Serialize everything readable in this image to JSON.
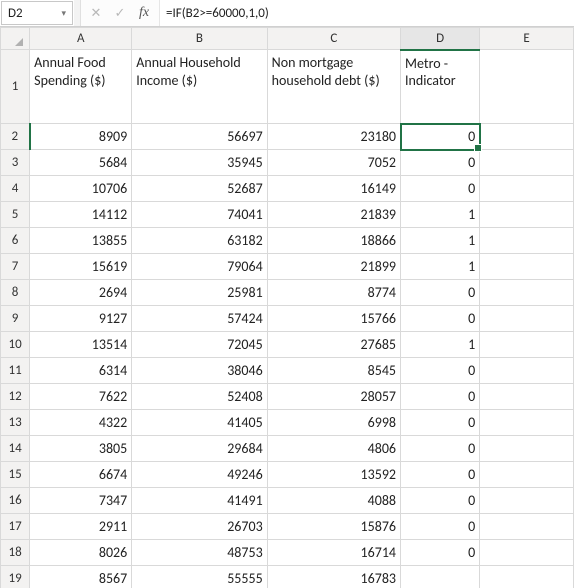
{
  "name_box": {
    "value": "D2",
    "dropdown_glyph": "▾"
  },
  "formula_bar": {
    "cancel_glyph": "✕",
    "enter_glyph": "✓",
    "fx_label": "fx",
    "formula": "=IF(B2>=60000,1,0)"
  },
  "column_headers": [
    "A",
    "B",
    "C",
    "D",
    "E"
  ],
  "header_row_label": "1",
  "headers": {
    "A": "Annual Food Spending ($)",
    "B": "Annual Household Income         ($)",
    "C": "Non mortgage household debt ($)",
    "D": "Metro - Indicator",
    "E": ""
  },
  "row_labels": [
    "2",
    "3",
    "4",
    "5",
    "6",
    "7",
    "8",
    "9",
    "10",
    "11",
    "12",
    "13",
    "14",
    "15",
    "16",
    "17",
    "18",
    "19"
  ],
  "rows": [
    {
      "A": "8909",
      "B": "56697",
      "C": "23180",
      "D": "0",
      "E": ""
    },
    {
      "A": "5684",
      "B": "35945",
      "C": "7052",
      "D": "0",
      "E": ""
    },
    {
      "A": "10706",
      "B": "52687",
      "C": "16149",
      "D": "0",
      "E": ""
    },
    {
      "A": "14112",
      "B": "74041",
      "C": "21839",
      "D": "1",
      "E": ""
    },
    {
      "A": "13855",
      "B": "63182",
      "C": "18866",
      "D": "1",
      "E": ""
    },
    {
      "A": "15619",
      "B": "79064",
      "C": "21899",
      "D": "1",
      "E": ""
    },
    {
      "A": "2694",
      "B": "25981",
      "C": "8774",
      "D": "0",
      "E": ""
    },
    {
      "A": "9127",
      "B": "57424",
      "C": "15766",
      "D": "0",
      "E": ""
    },
    {
      "A": "13514",
      "B": "72045",
      "C": "27685",
      "D": "1",
      "E": ""
    },
    {
      "A": "6314",
      "B": "38046",
      "C": "8545",
      "D": "0",
      "E": ""
    },
    {
      "A": "7622",
      "B": "52408",
      "C": "28057",
      "D": "0",
      "E": ""
    },
    {
      "A": "4322",
      "B": "41405",
      "C": "6998",
      "D": "0",
      "E": ""
    },
    {
      "A": "3805",
      "B": "29684",
      "C": "4806",
      "D": "0",
      "E": ""
    },
    {
      "A": "6674",
      "B": "49246",
      "C": "13592",
      "D": "0",
      "E": ""
    },
    {
      "A": "7347",
      "B": "41491",
      "C": "4088",
      "D": "0",
      "E": ""
    },
    {
      "A": "2911",
      "B": "26703",
      "C": "15876",
      "D": "0",
      "E": ""
    },
    {
      "A": "8026",
      "B": "48753",
      "C": "16714",
      "D": "0",
      "E": ""
    },
    {
      "A": "8567",
      "B": "55555",
      "C": "16783",
      "D": "",
      "E": ""
    }
  ],
  "active": {
    "col": "D",
    "row_index": 0
  }
}
